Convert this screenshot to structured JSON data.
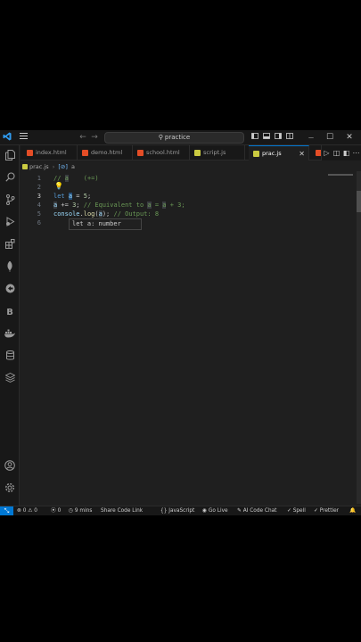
{
  "titlebar": {
    "search_text": "practice",
    "nav_back": "←",
    "nav_forward": "→",
    "minimize": "—",
    "maximize": "☐",
    "close": "✕"
  },
  "tabs": [
    {
      "label": "index.html",
      "type": "html"
    },
    {
      "label": "demo.html",
      "type": "html"
    },
    {
      "label": "school.html",
      "type": "html"
    },
    {
      "label": "script.js",
      "type": "js"
    },
    {
      "label": "prac.js",
      "type": "js",
      "active": true
    }
  ],
  "breadcrumb": {
    "file": "prac.js",
    "symbol": "a"
  },
  "editor": {
    "line_numbers": [
      "1",
      "2",
      "3",
      "4",
      "5",
      "6"
    ],
    "hover_text": "let a: number"
  },
  "statusbar": {
    "problems_errors": "0",
    "problems_warnings": "0",
    "ports": "0",
    "time": "9 mins",
    "share": "Share Code Link",
    "language": "JavaScript",
    "golive": "Go Live",
    "ai": "AI Code Chat",
    "spell": "Spell",
    "prettier": "Prettier"
  },
  "colors": {
    "accent": "#0078d4",
    "editor_bg": "#1f1f1f"
  }
}
